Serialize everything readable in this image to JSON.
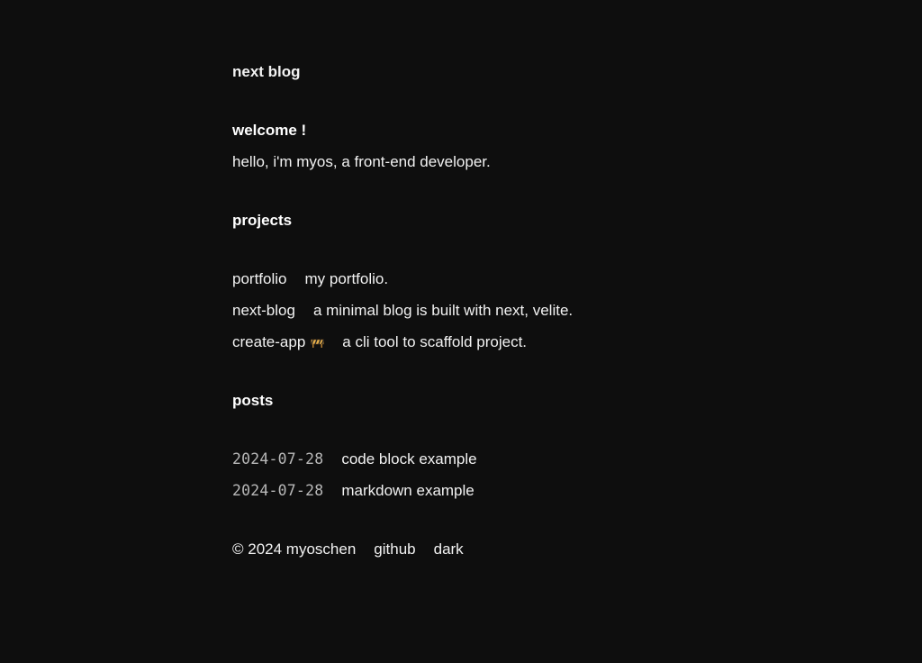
{
  "site": {
    "title": "next blog"
  },
  "welcome": {
    "heading": "welcome !",
    "intro": "hello, i'm myos, a front-end developer."
  },
  "projects": {
    "heading": "projects",
    "items": [
      {
        "name": "portfolio",
        "description": "my portfolio.",
        "icon": ""
      },
      {
        "name": "next-blog",
        "description": "a minimal blog is built with next, velite.",
        "icon": ""
      },
      {
        "name": "create-app",
        "description": "a cli tool to scaffold project.",
        "icon": "construction-barrier-icon"
      }
    ]
  },
  "posts": {
    "heading": "posts",
    "items": [
      {
        "date": "2024-07-28",
        "title": "code block example"
      },
      {
        "date": "2024-07-28",
        "title": "markdown example"
      }
    ]
  },
  "footer": {
    "copyright": "© 2024 myoschen",
    "github_label": "github",
    "theme_label": "dark"
  },
  "colors": {
    "background": "#0e0e0e",
    "text": "#f2f2f2",
    "date": "#b8b8b8"
  }
}
